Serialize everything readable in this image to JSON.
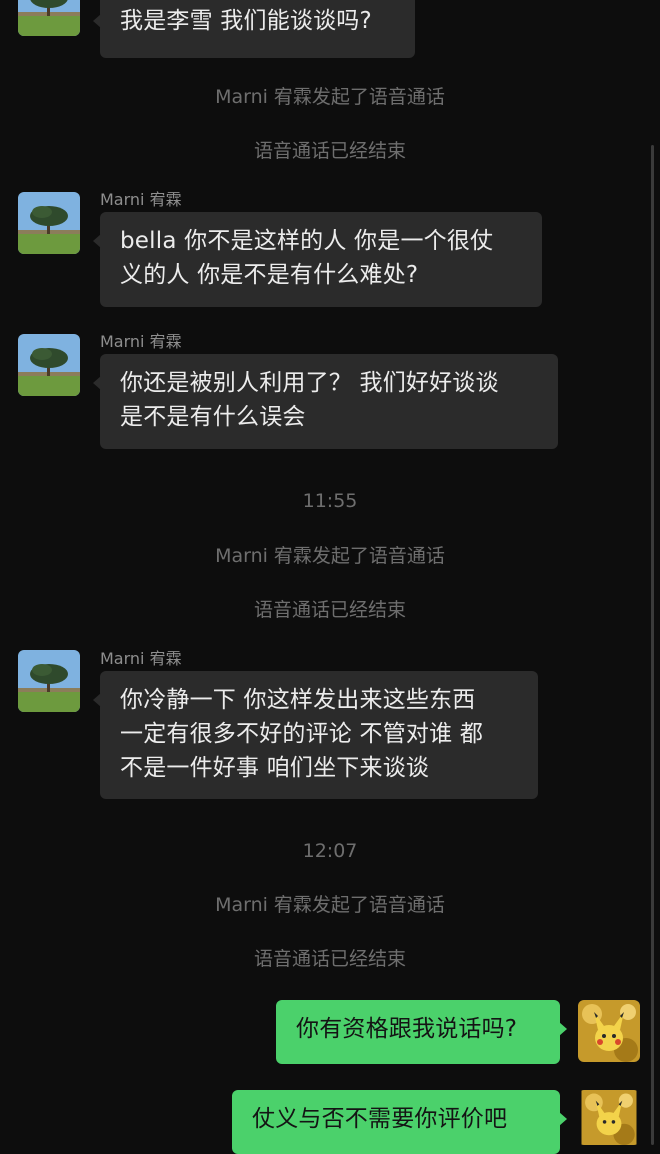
{
  "contact": {
    "name": "Marni 宥霖"
  },
  "icons": {
    "contact_avatar": "tree-landscape-avatar",
    "self_avatar": "gold-pikachu-avatar"
  },
  "colors": {
    "background": "#0d0d0d",
    "incoming_bubble": "#2b2b2b",
    "outgoing_bubble": "#4bd16b",
    "system_text": "#6e6e6e"
  },
  "messages": {
    "m0": {
      "lines": [
        "我是李雪 我们能谈谈吗?"
      ]
    },
    "sys1": "Marni 宥霖发起了语音通话",
    "sys2": "语音通话已经结束",
    "m1": {
      "sender": "Marni 宥霖",
      "lines": [
        "bella 你不是这样的人 你是一个很仗",
        "义的人 你是不是有什么难处?"
      ]
    },
    "m2": {
      "sender": "Marni 宥霖",
      "lines": [
        "你还是被别人利用了？  我们好好谈谈",
        "是不是有什么误会"
      ]
    },
    "time1": "11:55",
    "sys3": "Marni 宥霖发起了语音通话",
    "sys4": "语音通话已经结束",
    "m3": {
      "sender": "Marni 宥霖",
      "lines": [
        "你冷静一下 你这样发出来这些东西",
        "一定有很多不好的评论 不管对谁 都",
        "不是一件好事 咱们坐下来谈谈"
      ]
    },
    "time2": "12:07",
    "sys5": "Marni 宥霖发起了语音通话",
    "sys6": "语音通话已经结束",
    "out1": {
      "lines": [
        "你有资格跟我说话吗?"
      ]
    },
    "out2": {
      "lines": [
        "仗义与否不需要你评价吧"
      ]
    }
  }
}
